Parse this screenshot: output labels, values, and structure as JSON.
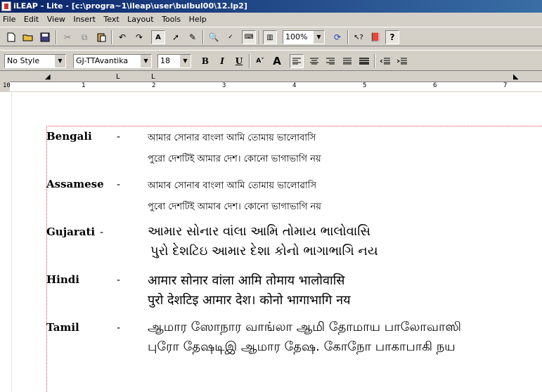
{
  "window": {
    "title": "iLEAP - Lite - [c:\\progra~1\\ileap\\user\\bulbul00\\12.lp2]"
  },
  "menu": [
    "File",
    "Edit",
    "View",
    "Insert",
    "Text",
    "Layout",
    "Tools",
    "Help"
  ],
  "toolbar": {
    "zoom": "100%"
  },
  "format_bar": {
    "style": "No Style",
    "font": "GJ-TTAvantika",
    "size": "18"
  },
  "ruler": {
    "labels": [
      "10",
      "1",
      "2",
      "3",
      "4",
      "5",
      "6",
      "7"
    ]
  },
  "document": {
    "rows": [
      {
        "language": "Bengali",
        "dash": "-",
        "line1": "আমার সোনার বাংলা আমি তোমায় ভালোবাসি",
        "line2": "পুরো দেশটিই আমার দেশ। কোনো ভাগাভাগি নয়"
      },
      {
        "language": "Assamese",
        "dash": "-",
        "line1": "আমাৰ সোনাৰ বাংলা আমি তোমায় ভালোৱাসি",
        "line2": "পুৰো দেশটিই আমাৰ দেশ। কোনো ভাগাভাগি নয়"
      },
      {
        "language": "Gujarati",
        "dash": "-",
        "line1": "આમાર સોનાર વાંલા આમિ તોમાય ભાલોવાસિ",
        "line2": "પુરો દેશટિઇ આમાર દેશ। કોનો ભાગાભાગિ નય"
      },
      {
        "language": "Hindi",
        "dash": "-",
        "line1": "आमार सोनार वांला आमि तोमाय भालोवासि",
        "line2": "पुरो देशटिइ आमार देश। कोनो भागाभागि नय"
      },
      {
        "language": "Tamil",
        "dash": "-",
        "line1": "ஆமார ஸோநார வாங்லா ஆமி தோமாய பாலோவாஸி",
        "line2": "புரோ தேஷடிஇ ஆமார தேஷ. கோநோ பாகாபாகி நய"
      }
    ]
  }
}
